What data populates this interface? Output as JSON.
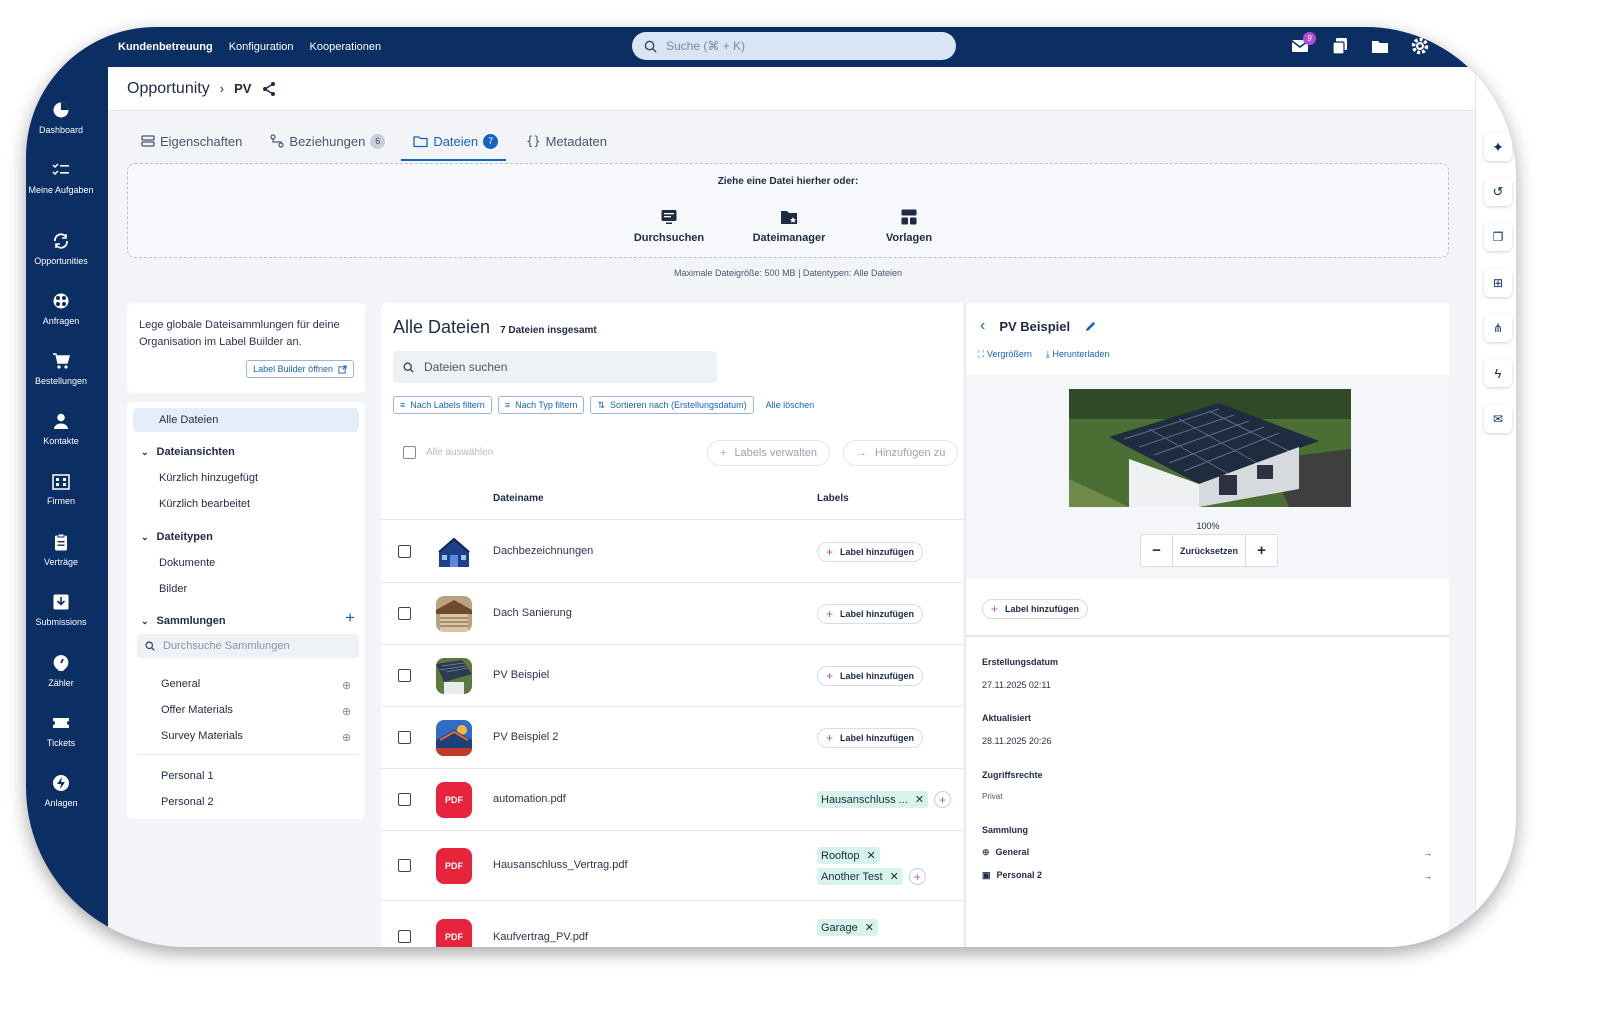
{
  "topbar": {
    "nav": [
      "Kundenbetreuung",
      "Konfiguration",
      "Kooperationen"
    ],
    "search_placeholder": "Suche (⌘ + K)",
    "mail_badge": "9"
  },
  "sidebar": [
    {
      "label": "Dashboard",
      "icon": "pie-chart-icon"
    },
    {
      "label": "Meine Aufgaben",
      "icon": "checklist-icon"
    },
    {
      "label": "Opportunities",
      "icon": "refresh-icon"
    },
    {
      "label": "Anfragen",
      "icon": "globe-icon"
    },
    {
      "label": "Bestellungen",
      "icon": "cart-icon"
    },
    {
      "label": "Kontakte",
      "icon": "person-icon"
    },
    {
      "label": "Firmen",
      "icon": "building-icon"
    },
    {
      "label": "Verträge",
      "icon": "clipboard-icon"
    },
    {
      "label": "Submissions",
      "icon": "inbox-icon"
    },
    {
      "label": "Zähler",
      "icon": "gauge-icon"
    },
    {
      "label": "Tickets",
      "icon": "ticket-icon"
    },
    {
      "label": "Anlagen",
      "icon": "bolt-icon"
    }
  ],
  "breadcrumb": {
    "root": "Opportunity",
    "current": "PV"
  },
  "tabs": [
    {
      "label": "Eigenschaften",
      "count": ""
    },
    {
      "label": "Beziehungen",
      "count": "6"
    },
    {
      "label": "Dateien",
      "count": "7"
    },
    {
      "label": "Metadaten",
      "count": ""
    }
  ],
  "upload": {
    "title": "Ziehe eine Datei hierher oder:",
    "options": [
      "Durchsuchen",
      "Dateimanager",
      "Vorlagen"
    ],
    "info": "Maximale Dateigröße: 500 MB  |  Datentypen: Alle Dateien"
  },
  "label_info": {
    "text": "Lege globale Dateisammlungen für deine Organisation im Label Builder an.",
    "button": "Label Builder öffnen"
  },
  "tree": {
    "all": "Alle Dateien",
    "views_title": "Dateiansichten",
    "views": [
      "Kürzlich hinzugefügt",
      "Kürzlich bearbeitet"
    ],
    "types_title": "Dateitypen",
    "types": [
      "Dokumente",
      "Bilder"
    ],
    "collections_title": "Sammlungen",
    "collections_search": "Durchsuche Sammlungen",
    "global_collections": [
      "General",
      "Offer Materials",
      "Survey Materials"
    ],
    "personal_collections": [
      "Personal 1",
      "Personal 2"
    ]
  },
  "files": {
    "title": "Alle Dateien",
    "total": "7 Dateien insgesamt",
    "search_placeholder": "Dateien suchen",
    "filters": [
      "Nach Labels filtern",
      "Nach Typ filtern",
      "Sortieren nach (Erstellungsdatum)"
    ],
    "clear": "Alle löschen",
    "select_all": "Alle auswählen",
    "manage_labels": "Labels verwalten",
    "add_to": "Hinzufügen zu",
    "col_name": "Dateiname",
    "col_labels": "Labels",
    "add_label": "Label hinzufügen",
    "pdf_text": "PDF",
    "rows": [
      {
        "name": "Dachbezeichnungen",
        "labels": []
      },
      {
        "name": "Dach Sanierung",
        "labels": []
      },
      {
        "name": "PV Beispiel",
        "labels": []
      },
      {
        "name": "PV Beispiel 2",
        "labels": []
      },
      {
        "name": "automation.pdf",
        "labels": [
          "Hausanschluss ..."
        ]
      },
      {
        "name": "Hausanschluss_Vertrag.pdf",
        "labels": [
          "Rooftop",
          "Another Test"
        ]
      },
      {
        "name": "Kaufvertrag_PV.pdf",
        "labels": [
          "Garage"
        ]
      }
    ]
  },
  "detail": {
    "title": "PV Beispiel",
    "enlarge": "Vergrößern",
    "download": "Herunterladen",
    "zoom": "100%",
    "reset": "Zurücksetzen",
    "add_label": "Label hinzufügen",
    "created_label": "Erstellungsdatum",
    "created": "27.11.2025 02:11",
    "updated_label": "Aktualisiert",
    "updated": "28.11.2025 20:26",
    "access_label": "Zugriffsrechte",
    "access": "Privat",
    "collection_label": "Sammlung",
    "collections": [
      "General",
      "Personal 2"
    ]
  },
  "colors": {
    "navy": "#0b2e63",
    "accent": "#1565c0",
    "pdf": "#e8233c",
    "tag": "#d8f3ea",
    "purple": "#b44bd6"
  }
}
